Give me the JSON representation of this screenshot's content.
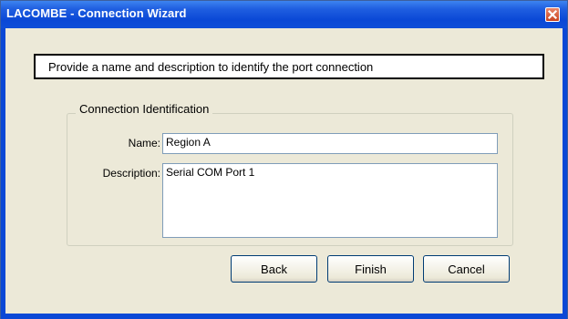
{
  "window": {
    "title": "LACOMBE - Connection Wizard",
    "close_icon": "close-icon"
  },
  "header": {
    "text": "Provide a name and description to identify the port connection"
  },
  "group": {
    "legend": "Connection Identification",
    "name_label": "Name:",
    "name_value": "Region A",
    "description_label": "Description:",
    "description_value": "Serial COM Port 1"
  },
  "buttons": {
    "back": "Back",
    "finish": "Finish",
    "cancel": "Cancel"
  },
  "colors": {
    "titlebar": "#0a48d6",
    "face": "#ece9d8",
    "close": "#d4502a"
  }
}
